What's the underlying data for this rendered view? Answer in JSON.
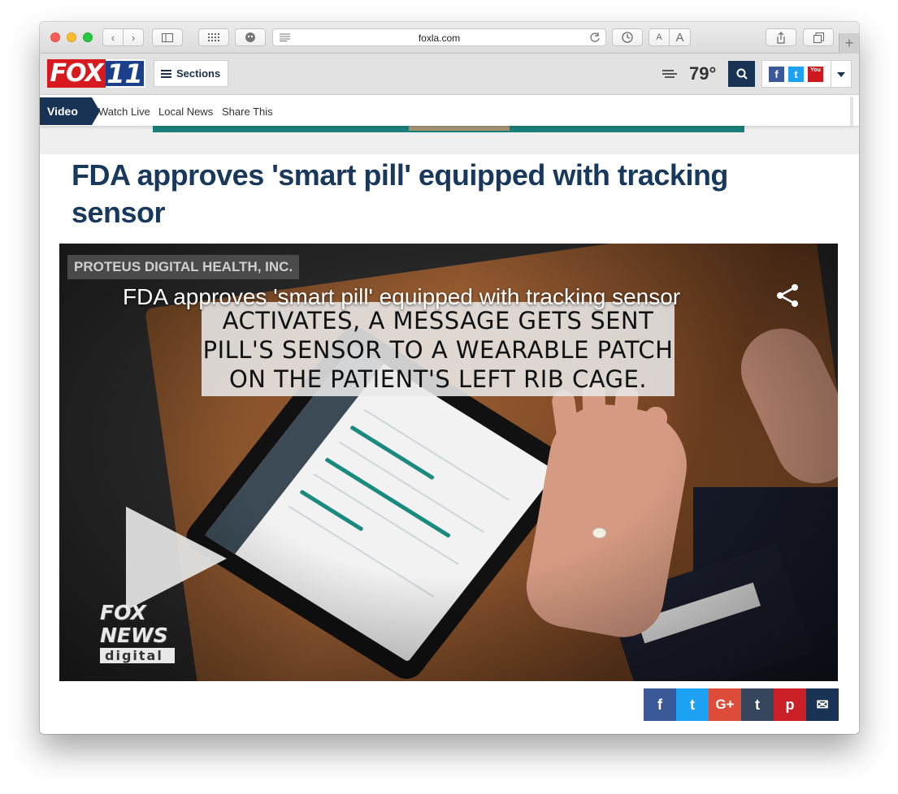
{
  "browser": {
    "url": "foxla.com",
    "reader_label_small": "A",
    "reader_label_large": "A",
    "new_tab_label": "+"
  },
  "header": {
    "logo_fox": "FOX",
    "logo_number": "11",
    "sections_label": "Sections",
    "temperature": "79°",
    "social": {
      "facebook": "f",
      "twitter": "t",
      "youtube": "You"
    }
  },
  "subnav": {
    "video_label": "Video",
    "links": [
      "Watch Live",
      "Local News",
      "Share This"
    ]
  },
  "article": {
    "title": "FDA approves 'smart pill' equipped with tracking sensor"
  },
  "video": {
    "title": "FDA approves 'smart pill' equipped with tracking sensor",
    "credit": "PROTEUS DIGITAL HEALTH, INC.",
    "caption_lines": [
      "ACTIVATES, A MESSAGE GETS SENT",
      "PILL'S SENSOR TO A WEARABLE PATCH",
      "ON THE PATIENT'S LEFT RIB CAGE."
    ],
    "badge_line1": "FOX",
    "badge_line2": "NEWS",
    "badge_line3": "digital"
  },
  "share": [
    {
      "name": "facebook",
      "glyph": "f",
      "color": "#3b5998"
    },
    {
      "name": "twitter",
      "glyph": "t",
      "color": "#1da1f2"
    },
    {
      "name": "googleplus",
      "glyph": "G+",
      "color": "#dd4b39"
    },
    {
      "name": "tumblr",
      "glyph": "t",
      "color": "#35465c"
    },
    {
      "name": "pinterest",
      "glyph": "p",
      "color": "#cb2027"
    },
    {
      "name": "email",
      "glyph": "✉",
      "color": "#183354"
    }
  ]
}
